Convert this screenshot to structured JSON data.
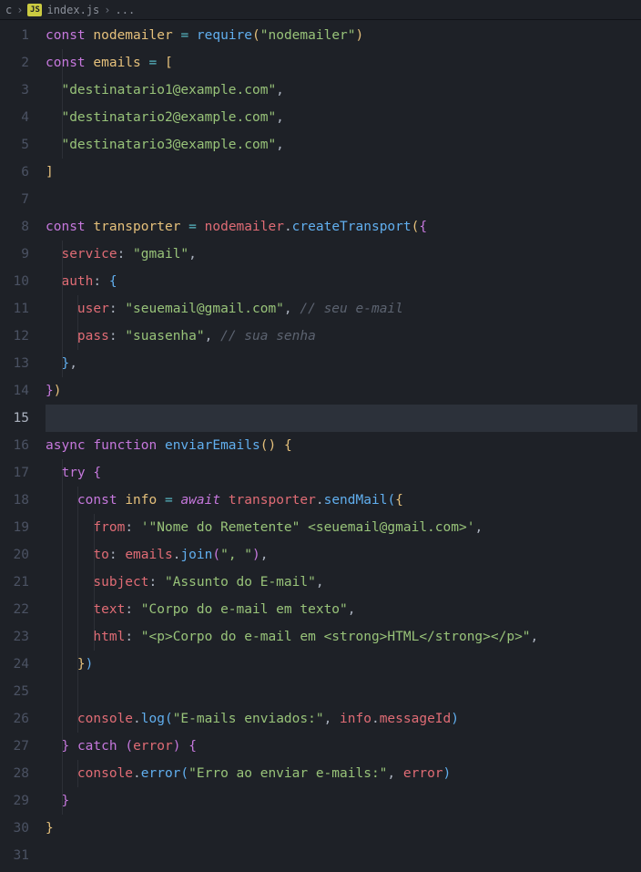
{
  "breadcrumb": {
    "part0": "c",
    "icon_label": "JS",
    "file": "index.js",
    "tail": "..."
  },
  "code": {
    "lines": [
      [
        [
          "c-k",
          "const"
        ],
        [
          "c-w",
          " "
        ],
        [
          "c-d",
          "nodemailer"
        ],
        [
          "c-w",
          " "
        ],
        [
          "c-o",
          "="
        ],
        [
          "c-w",
          " "
        ],
        [
          "c-f",
          "require"
        ],
        [
          "c-y",
          "("
        ],
        [
          "c-s",
          "\"nodemailer\""
        ],
        [
          "c-y",
          ")"
        ]
      ],
      [
        [
          "c-k",
          "const"
        ],
        [
          "c-w",
          " "
        ],
        [
          "c-d",
          "emails"
        ],
        [
          "c-w",
          " "
        ],
        [
          "c-o",
          "="
        ],
        [
          "c-w",
          " "
        ],
        [
          "c-y",
          "["
        ]
      ],
      [
        [
          "c-w",
          "  "
        ],
        [
          "c-s",
          "\"destinatario1@example.com\""
        ],
        [
          "c-w",
          ","
        ]
      ],
      [
        [
          "c-w",
          "  "
        ],
        [
          "c-s",
          "\"destinatario2@example.com\""
        ],
        [
          "c-w",
          ","
        ]
      ],
      [
        [
          "c-w",
          "  "
        ],
        [
          "c-s",
          "\"destinatario3@example.com\""
        ],
        [
          "c-w",
          ","
        ]
      ],
      [
        [
          "c-y",
          "]"
        ]
      ],
      [],
      [
        [
          "c-k",
          "const"
        ],
        [
          "c-w",
          " "
        ],
        [
          "c-d",
          "transporter"
        ],
        [
          "c-w",
          " "
        ],
        [
          "c-o",
          "="
        ],
        [
          "c-w",
          " "
        ],
        [
          "c-v",
          "nodemailer"
        ],
        [
          "c-w",
          "."
        ],
        [
          "c-f",
          "createTransport"
        ],
        [
          "c-y",
          "("
        ],
        [
          "c-p",
          "{"
        ]
      ],
      [
        [
          "c-w",
          "  "
        ],
        [
          "c-v",
          "service"
        ],
        [
          "c-w",
          ": "
        ],
        [
          "c-s",
          "\"gmail\""
        ],
        [
          "c-w",
          ","
        ]
      ],
      [
        [
          "c-w",
          "  "
        ],
        [
          "c-v",
          "auth"
        ],
        [
          "c-w",
          ": "
        ],
        [
          "c-b",
          "{"
        ]
      ],
      [
        [
          "c-w",
          "    "
        ],
        [
          "c-v",
          "user"
        ],
        [
          "c-w",
          ": "
        ],
        [
          "c-s",
          "\"seuemail@gmail.com\""
        ],
        [
          "c-w",
          ", "
        ],
        [
          "c-c",
          "// seu e-mail"
        ]
      ],
      [
        [
          "c-w",
          "    "
        ],
        [
          "c-v",
          "pass"
        ],
        [
          "c-w",
          ": "
        ],
        [
          "c-s",
          "\"suasenha\""
        ],
        [
          "c-w",
          ", "
        ],
        [
          "c-c",
          "// sua senha"
        ]
      ],
      [
        [
          "c-w",
          "  "
        ],
        [
          "c-b",
          "}"
        ],
        [
          "c-w",
          ","
        ]
      ],
      [
        [
          "c-p",
          "}"
        ],
        [
          "c-y",
          ")"
        ]
      ],
      [],
      [
        [
          "c-k",
          "async"
        ],
        [
          "c-w",
          " "
        ],
        [
          "c-k",
          "function"
        ],
        [
          "c-w",
          " "
        ],
        [
          "c-f",
          "enviarEmails"
        ],
        [
          "c-y",
          "()"
        ],
        [
          "c-w",
          " "
        ],
        [
          "c-y",
          "{"
        ]
      ],
      [
        [
          "c-w",
          "  "
        ],
        [
          "c-k",
          "try"
        ],
        [
          "c-w",
          " "
        ],
        [
          "c-p",
          "{"
        ]
      ],
      [
        [
          "c-w",
          "    "
        ],
        [
          "c-k",
          "const"
        ],
        [
          "c-w",
          " "
        ],
        [
          "c-d",
          "info"
        ],
        [
          "c-w",
          " "
        ],
        [
          "c-o",
          "="
        ],
        [
          "c-w",
          " "
        ],
        [
          "c-i",
          "await"
        ],
        [
          "c-w",
          " "
        ],
        [
          "c-v",
          "transporter"
        ],
        [
          "c-w",
          "."
        ],
        [
          "c-f",
          "sendMail"
        ],
        [
          "c-b",
          "("
        ],
        [
          "c-y",
          "{"
        ]
      ],
      [
        [
          "c-w",
          "      "
        ],
        [
          "c-v",
          "from"
        ],
        [
          "c-w",
          ": "
        ],
        [
          "c-s",
          "'\"Nome do Remetente\" <seuemail@gmail.com>'"
        ],
        [
          "c-w",
          ","
        ]
      ],
      [
        [
          "c-w",
          "      "
        ],
        [
          "c-v",
          "to"
        ],
        [
          "c-w",
          ": "
        ],
        [
          "c-v",
          "emails"
        ],
        [
          "c-w",
          "."
        ],
        [
          "c-f",
          "join"
        ],
        [
          "c-p",
          "("
        ],
        [
          "c-s",
          "\", \""
        ],
        [
          "c-p",
          ")"
        ],
        [
          "c-w",
          ","
        ]
      ],
      [
        [
          "c-w",
          "      "
        ],
        [
          "c-v",
          "subject"
        ],
        [
          "c-w",
          ": "
        ],
        [
          "c-s",
          "\"Assunto do E-mail\""
        ],
        [
          "c-w",
          ","
        ]
      ],
      [
        [
          "c-w",
          "      "
        ],
        [
          "c-v",
          "text"
        ],
        [
          "c-w",
          ": "
        ],
        [
          "c-s",
          "\"Corpo do e-mail em texto\""
        ],
        [
          "c-w",
          ","
        ]
      ],
      [
        [
          "c-w",
          "      "
        ],
        [
          "c-v",
          "html"
        ],
        [
          "c-w",
          ": "
        ],
        [
          "c-s",
          "\"<p>Corpo do e-mail em <strong>HTML</strong></p>\""
        ],
        [
          "c-w",
          ","
        ]
      ],
      [
        [
          "c-w",
          "    "
        ],
        [
          "c-y",
          "}"
        ],
        [
          "c-b",
          ")"
        ]
      ],
      [],
      [
        [
          "c-w",
          "    "
        ],
        [
          "c-v",
          "console"
        ],
        [
          "c-w",
          "."
        ],
        [
          "c-f",
          "log"
        ],
        [
          "c-b",
          "("
        ],
        [
          "c-s",
          "\"E-mails enviados:\""
        ],
        [
          "c-w",
          ", "
        ],
        [
          "c-v",
          "info"
        ],
        [
          "c-w",
          "."
        ],
        [
          "c-v",
          "messageId"
        ],
        [
          "c-b",
          ")"
        ]
      ],
      [
        [
          "c-w",
          "  "
        ],
        [
          "c-p",
          "}"
        ],
        [
          "c-w",
          " "
        ],
        [
          "c-k",
          "catch"
        ],
        [
          "c-w",
          " "
        ],
        [
          "c-p",
          "("
        ],
        [
          "c-v",
          "error"
        ],
        [
          "c-p",
          ")"
        ],
        [
          "c-w",
          " "
        ],
        [
          "c-p",
          "{"
        ]
      ],
      [
        [
          "c-w",
          "    "
        ],
        [
          "c-v",
          "console"
        ],
        [
          "c-w",
          "."
        ],
        [
          "c-f",
          "error"
        ],
        [
          "c-b",
          "("
        ],
        [
          "c-s",
          "\"Erro ao enviar e-mails:\""
        ],
        [
          "c-w",
          ", "
        ],
        [
          "c-v",
          "error"
        ],
        [
          "c-b",
          ")"
        ]
      ],
      [
        [
          "c-w",
          "  "
        ],
        [
          "c-p",
          "}"
        ]
      ],
      [
        [
          "c-y",
          "}"
        ]
      ],
      []
    ],
    "activeLine": 15,
    "indentGuides": {
      "2": [
        1
      ],
      "3": [
        1
      ],
      "4": [
        1
      ],
      "5": [
        1
      ],
      "9": [
        1
      ],
      "10": [
        1
      ],
      "11": [
        1,
        2
      ],
      "12": [
        1,
        2
      ],
      "13": [
        1
      ],
      "17": [
        1
      ],
      "18": [
        1,
        2
      ],
      "19": [
        1,
        2,
        3
      ],
      "20": [
        1,
        2,
        3
      ],
      "21": [
        1,
        2,
        3
      ],
      "22": [
        1,
        2,
        3
      ],
      "23": [
        1,
        2,
        3
      ],
      "24": [
        1,
        2
      ],
      "25": [
        1,
        2
      ],
      "26": [
        1,
        2
      ],
      "27": [
        1
      ],
      "28": [
        1,
        2
      ],
      "29": [
        1
      ]
    }
  }
}
